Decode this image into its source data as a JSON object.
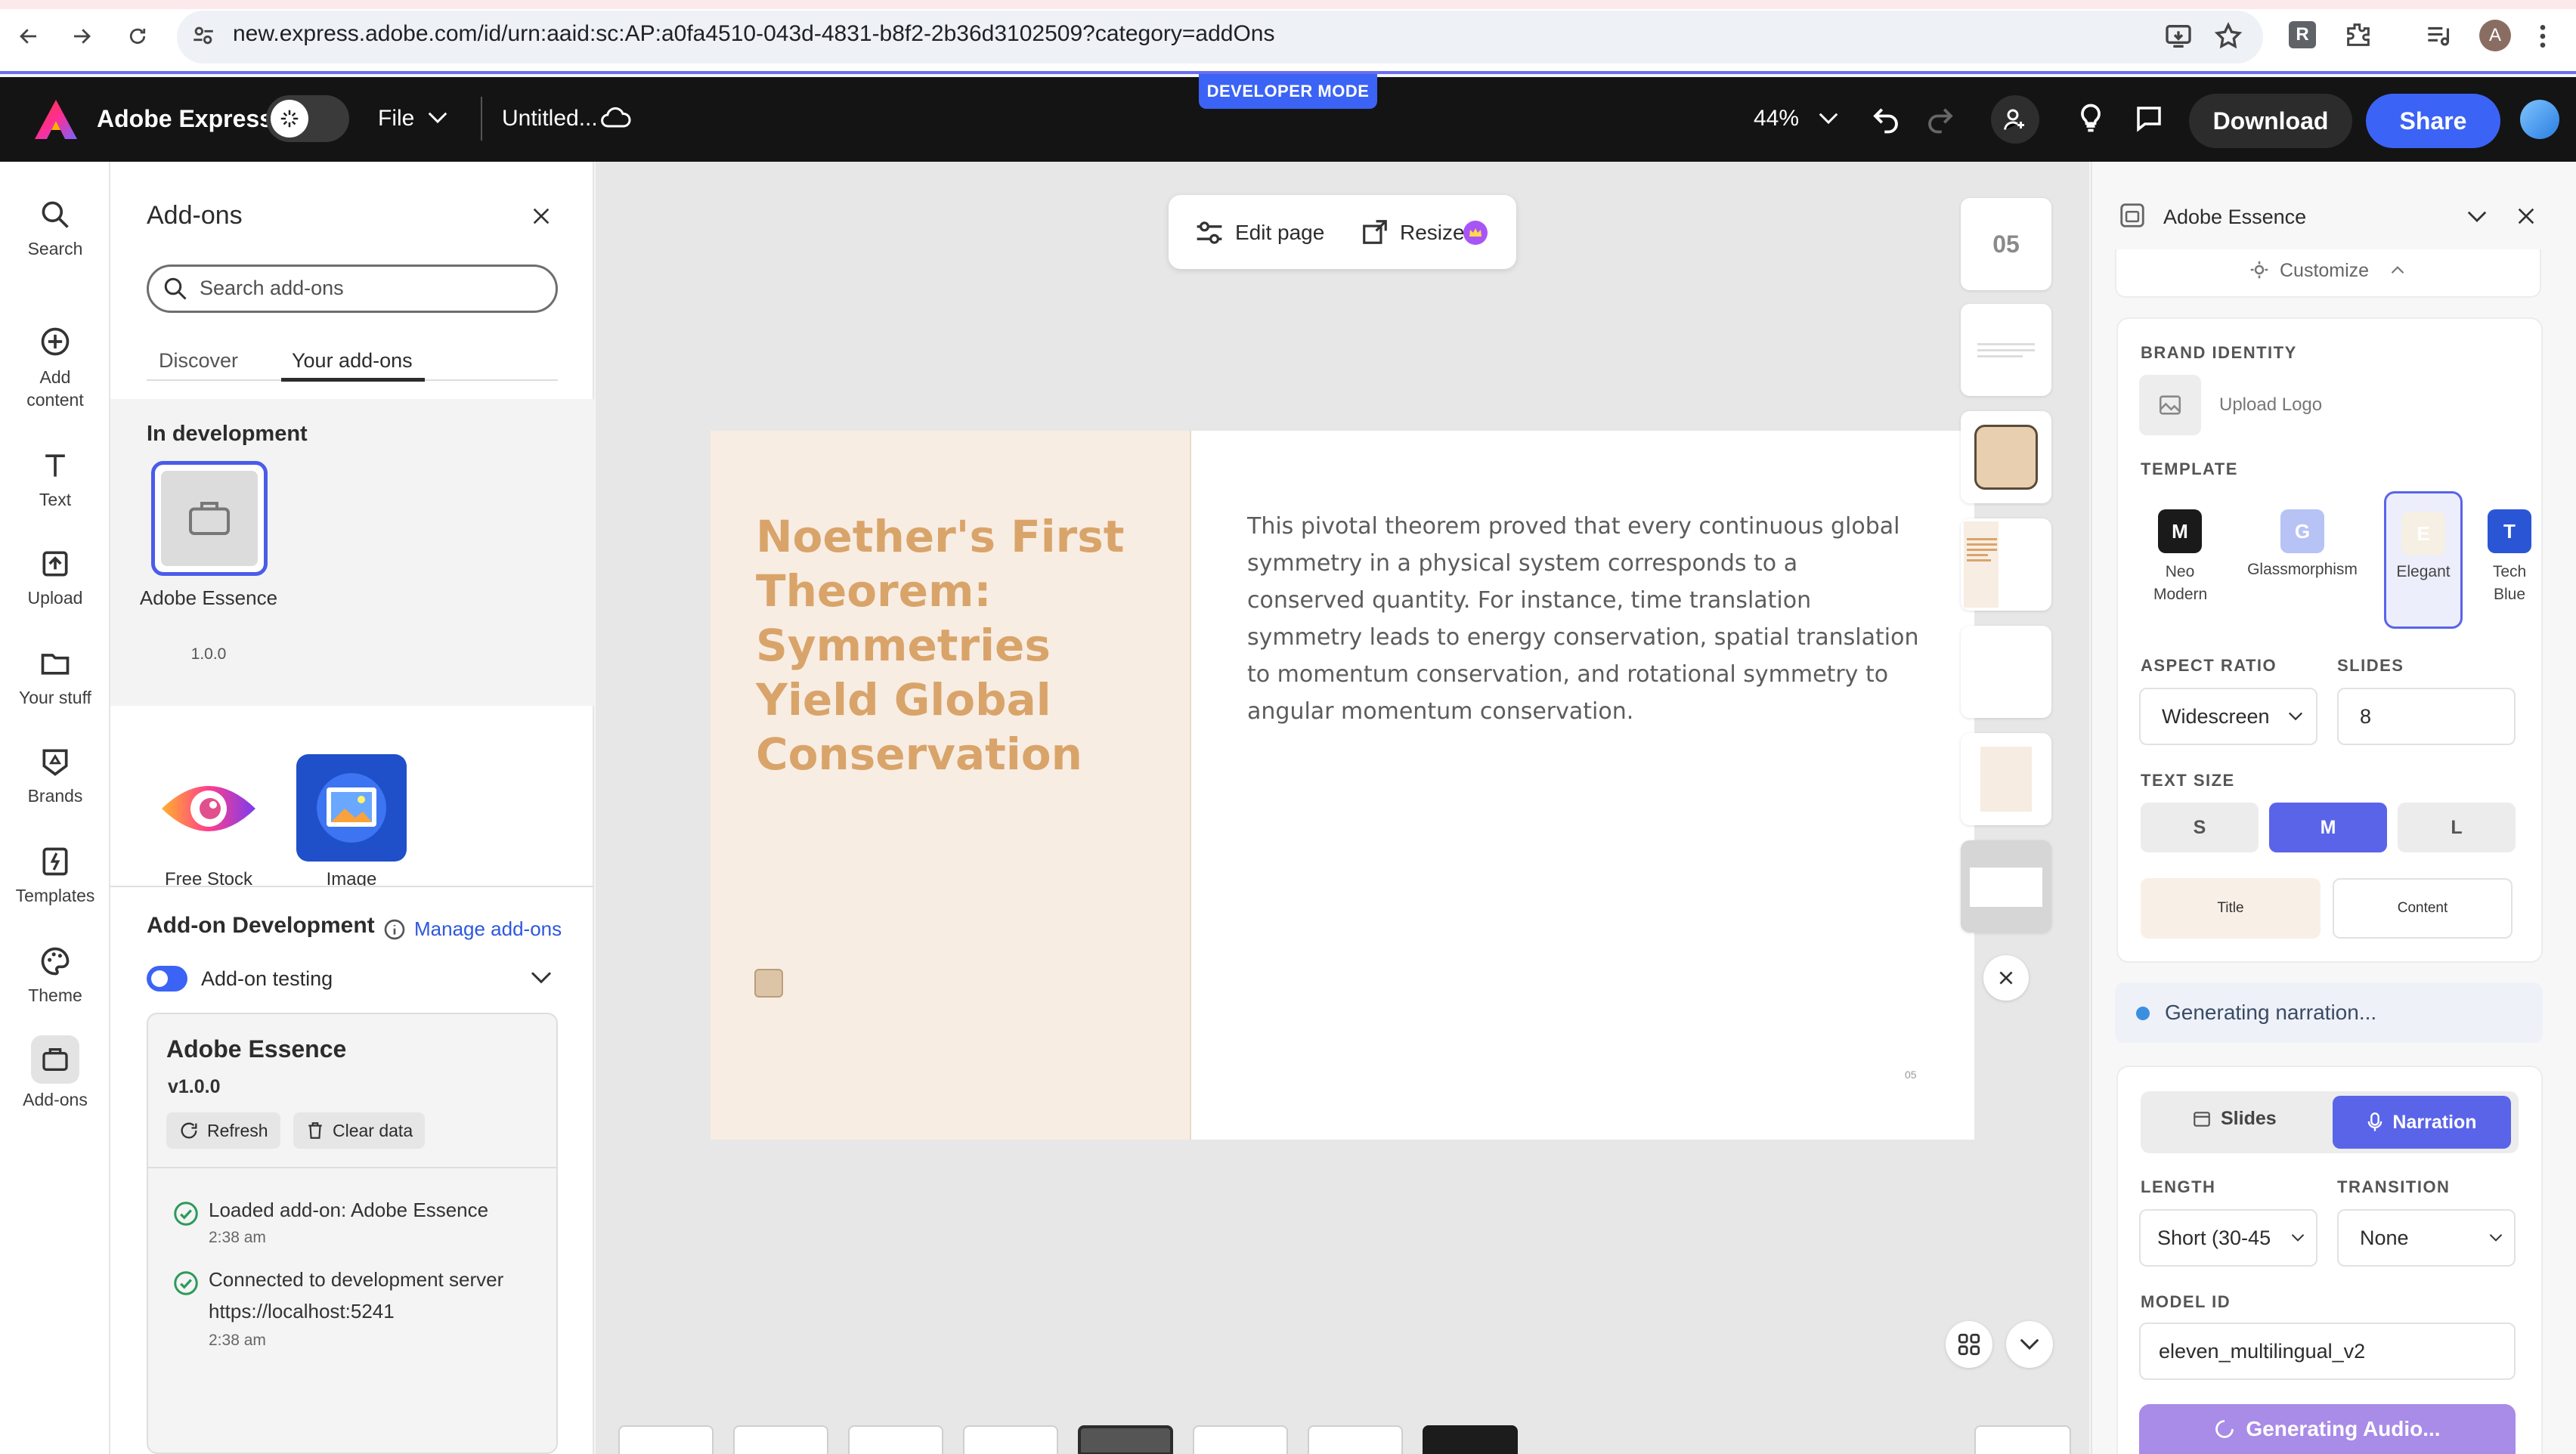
{
  "browser": {
    "url": "new.express.adobe.com/id/urn:aaid:sc:AP:a0fa4510-043d-4831-b8f2-2b36d3102509?category=addOns",
    "profile_initial": "A",
    "ext_initial": "R"
  },
  "header": {
    "app_name": "Adobe Express",
    "file_menu": "File",
    "doc_title": "Untitled...",
    "dev_badge": "DEVELOPER MODE",
    "zoom": "44%",
    "download": "Download",
    "share": "Share"
  },
  "rail": {
    "items": [
      "Search",
      "Add content",
      "Text",
      "Upload",
      "Your stuff",
      "Brands",
      "Templates",
      "Theme",
      "Add-ons"
    ]
  },
  "addons": {
    "title": "Add-ons",
    "search_placeholder": "Search add-ons",
    "tabs": [
      "Discover",
      "Your add-ons"
    ],
    "in_dev_heading": "In development",
    "dev_addon_name": "Adobe Essence",
    "dev_addon_version": "1.0.0",
    "other_addons": [
      "Free Stock",
      "Image"
    ],
    "dev_section_title": "Add-on Development",
    "manage_link": "Manage add-ons",
    "testing_label": "Add-on testing",
    "card_name": "Adobe Essence",
    "card_version": "v1.0.0",
    "refresh": "Refresh",
    "clear_data": "Clear data",
    "log": [
      {
        "text": "Loaded add-on: Adobe Essence",
        "time": "2:38 am"
      },
      {
        "text": "Connected to development server",
        "url": "https://localhost:5241",
        "time": "2:38 am"
      }
    ]
  },
  "canvas": {
    "edit_page": "Edit page",
    "resize": "Resize",
    "slide_title": "Noether's First Theorem: Symmetries Yield Global Conservation",
    "slide_body": "This pivotal theorem proved that every continuous global symmetry in a physical system corresponds to a conserved quantity. For instance, time translation symmetry leads to energy conservation, spatial translation to momentum conservation, and rotational symmetry to angular momentum conservation.",
    "slide_number": "05",
    "page_thumb_label": "05"
  },
  "panel": {
    "title": "Adobe Essence",
    "customize": "Customize",
    "brand_identity": "BRAND IDENTITY",
    "upload_logo": "Upload Logo",
    "template": "TEMPLATE",
    "templates": [
      {
        "initial": "M",
        "name": "Neo Modern",
        "color": "#1a1a1a"
      },
      {
        "initial": "G",
        "name": "Glassmorphism",
        "color": "#b7c3f5"
      },
      {
        "initial": "E",
        "name": "Elegant",
        "color": "#f6efe4"
      },
      {
        "initial": "T",
        "name": "Tech Blue",
        "color": "#2a56d6"
      }
    ],
    "aspect_ratio": "ASPECT RATIO",
    "aspect_value": "Widescreen",
    "slides_label": "SLIDES",
    "slides_value": "8",
    "text_size": "TEXT SIZE",
    "sizes": [
      "S",
      "M",
      "L"
    ],
    "title_btn": "Title",
    "content_btn": "Content",
    "status": "Generating narration...",
    "mode_slides": "Slides",
    "mode_narration": "Narration",
    "length_label": "LENGTH",
    "length_value": "Short (30-45",
    "transition_label": "TRANSITION",
    "transition_value": "None",
    "model_label": "MODEL ID",
    "model_value": "eleven_multilingual_v2",
    "generate_btn": "Generating Audio..."
  }
}
